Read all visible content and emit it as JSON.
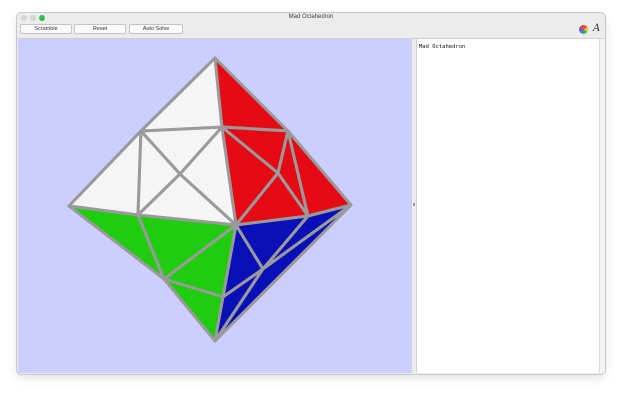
{
  "window": {
    "title": "Mad Octahedron"
  },
  "toolbar": {
    "scramble_label": "Scramble",
    "reset_label": "Reset",
    "auto_solve_label": "Auto Solve",
    "color_icon": "color-wheel-icon",
    "font_icon": "font-icon",
    "font_icon_glyph": "A"
  },
  "viewport": {
    "background": "#cccffd",
    "colors": {
      "white": "#f5f5f5",
      "red": "#e60a14",
      "green": "#20cc10",
      "blue": "#0a10b8",
      "edge": "#9a9a9a"
    }
  },
  "text_panel": {
    "content": "Mad Octahedron"
  }
}
